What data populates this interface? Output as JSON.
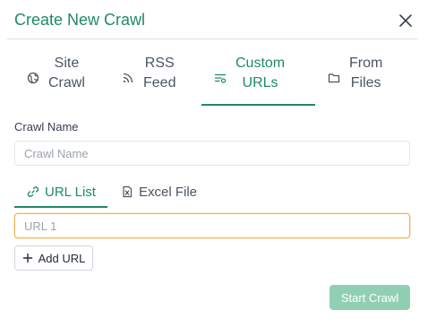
{
  "dialog": {
    "title": "Create New Crawl",
    "accent_color": "#1f8a63"
  },
  "tabs": [
    {
      "line1": "Site",
      "line2": "Crawl",
      "icon": "globe-icon",
      "active": false
    },
    {
      "line1": "RSS",
      "line2": "Feed",
      "icon": "rss-icon",
      "active": false
    },
    {
      "line1": "Custom",
      "line2": "URLs",
      "icon": "list-settings-icon",
      "active": true
    },
    {
      "line1": "From",
      "line2": "Files",
      "icon": "folder-icon",
      "active": false
    }
  ],
  "crawl_name": {
    "label": "Crawl Name",
    "placeholder": "Crawl Name",
    "value": ""
  },
  "subtabs": [
    {
      "label": "URL List",
      "icon": "link-icon",
      "active": true
    },
    {
      "label": "Excel File",
      "icon": "excel-file-icon",
      "active": false
    }
  ],
  "url_list": {
    "placeholder": "URL 1",
    "value": "",
    "focus_color": "#f0b25a"
  },
  "add_url": {
    "label": "Add URL"
  },
  "start_crawl": {
    "label": "Start Crawl",
    "color": "#91cfb3"
  }
}
